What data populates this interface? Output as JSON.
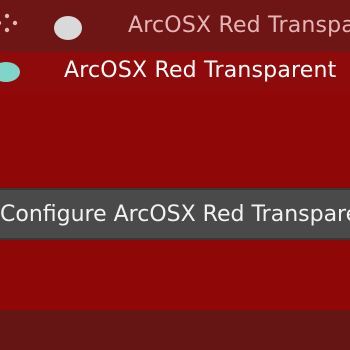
{
  "window": {
    "title": "ArcOSX Red Transparent",
    "menu_icon": "dots-menu-icon"
  },
  "item": {
    "label": "ArcOSX Red Transparent"
  },
  "tooltip": {
    "text": "Configure ArcOSX Red Transparent"
  },
  "colors": {
    "background": "#860808",
    "titlebar": "#6e1515",
    "tooltip_bg": "#4a4a4a",
    "indicator_dot": "#7fd6c8",
    "title_dot": "#d9d9d9"
  }
}
